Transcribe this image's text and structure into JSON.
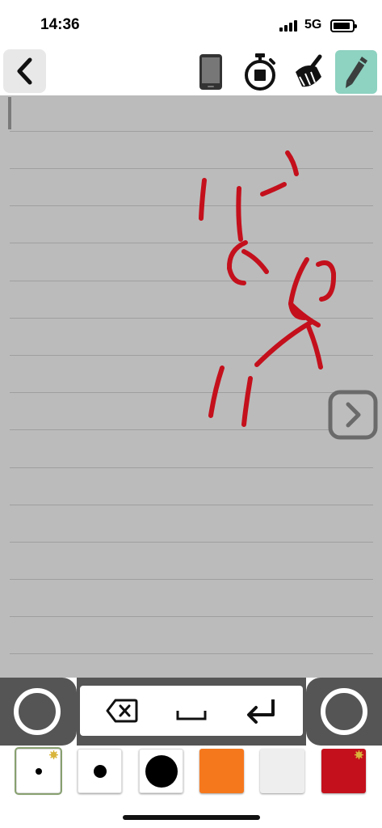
{
  "status": {
    "time": "14:36",
    "network": "5G"
  },
  "toolbar": {
    "back_icon": "chevron-left-icon",
    "tools": [
      "phone-icon",
      "stopwatch-icon",
      "broom-icon",
      "pencil-icon"
    ],
    "active_tool": "pencil-icon",
    "active_color": "#8ed2c1"
  },
  "canvas": {
    "background": "#bbbbbb",
    "ink_color": "#c4101c",
    "next_icon": "chevron-right-icon"
  },
  "keys": {
    "items": [
      "backspace-icon",
      "space-icon",
      "return-icon"
    ]
  },
  "swatches": {
    "selected_index": 0,
    "items": [
      {
        "kind": "pen-size-small",
        "color": "#ffffff",
        "settings": true
      },
      {
        "kind": "pen-size-medium",
        "color": "#ffffff",
        "settings": false
      },
      {
        "kind": "pen-size-large",
        "color": "#ffffff",
        "settings": false
      },
      {
        "kind": "color",
        "color": "#f6781d",
        "settings": false
      },
      {
        "kind": "color",
        "color": "#eeeeee",
        "settings": false
      },
      {
        "kind": "color",
        "color": "#c4101c",
        "settings": true
      }
    ]
  }
}
